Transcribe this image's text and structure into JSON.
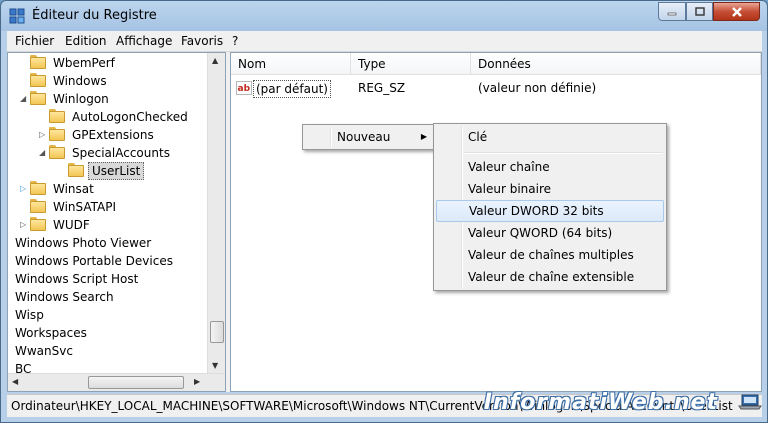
{
  "window": {
    "title": "Éditeur du Registre"
  },
  "menu": [
    "Fichier",
    "Edition",
    "Affichage",
    "Favoris",
    "?"
  ],
  "tree": {
    "items": [
      {
        "label": "WbemPerf",
        "indent": 1,
        "expander": "none",
        "folder": true
      },
      {
        "label": "Windows",
        "indent": 1,
        "expander": "none",
        "folder": true
      },
      {
        "label": "Winlogon",
        "indent": 1,
        "expander": "expanded",
        "folder": true
      },
      {
        "label": "AutoLogonChecked",
        "indent": 2,
        "expander": "none",
        "folder": true
      },
      {
        "label": "GPExtensions",
        "indent": 2,
        "expander": "collapsed",
        "folder": true
      },
      {
        "label": "SpecialAccounts",
        "indent": 2,
        "expander": "expanded",
        "folder": true
      },
      {
        "label": "UserList",
        "indent": 3,
        "expander": "none",
        "folder": true,
        "selected": true
      },
      {
        "label": "Winsat",
        "indent": 1,
        "expander": "collapsed-blue",
        "folder": true
      },
      {
        "label": "WinSATAPI",
        "indent": 1,
        "expander": "none",
        "folder": true
      },
      {
        "label": "WUDF",
        "indent": 1,
        "expander": "collapsed",
        "folder": true
      },
      {
        "label": "Windows Photo Viewer",
        "indent": 0,
        "expander": "none",
        "folder": false
      },
      {
        "label": "Windows Portable Devices",
        "indent": 0,
        "expander": "none",
        "folder": false
      },
      {
        "label": "Windows Script Host",
        "indent": 0,
        "expander": "none",
        "folder": false
      },
      {
        "label": "Windows Search",
        "indent": 0,
        "expander": "none",
        "folder": false
      },
      {
        "label": "Wisp",
        "indent": 0,
        "expander": "none",
        "folder": false
      },
      {
        "label": "Workspaces",
        "indent": 0,
        "expander": "none",
        "folder": false
      },
      {
        "label": "WwanSvc",
        "indent": 0,
        "expander": "none",
        "folder": false
      },
      {
        "label": "BC",
        "indent": 0,
        "expander": "none",
        "folder": false
      }
    ]
  },
  "list": {
    "columns": [
      "Nom",
      "Type",
      "Données"
    ],
    "rows": [
      {
        "name": "(par défaut)",
        "type": "REG_SZ",
        "data": "(valeur non définie)",
        "icon": "string-value-icon"
      }
    ]
  },
  "context_menu": {
    "item": "Nouveau"
  },
  "submenu": {
    "items": [
      {
        "label": "Clé",
        "highlighted": false
      },
      {
        "label": "Valeur chaîne",
        "highlighted": false
      },
      {
        "label": "Valeur binaire",
        "highlighted": false
      },
      {
        "label": "Valeur DWORD 32 bits",
        "highlighted": true
      },
      {
        "label": "Valeur QWORD (64 bits)",
        "highlighted": false
      },
      {
        "label": "Valeur de chaînes multiples",
        "highlighted": false
      },
      {
        "label": "Valeur de chaîne extensible",
        "highlighted": false
      }
    ]
  },
  "statusbar": {
    "path": "Ordinateur\\HKEY_LOCAL_MACHINE\\SOFTWARE\\Microsoft\\Windows NT\\CurrentVersion\\Winlogon\\SpecialAccounts\\UserList"
  },
  "watermark": "InformatiWeb.net",
  "colors": {
    "selection": "#cce8ff",
    "highlight_border": "#a8c8ec",
    "title_bg": "#a5c3e3"
  }
}
